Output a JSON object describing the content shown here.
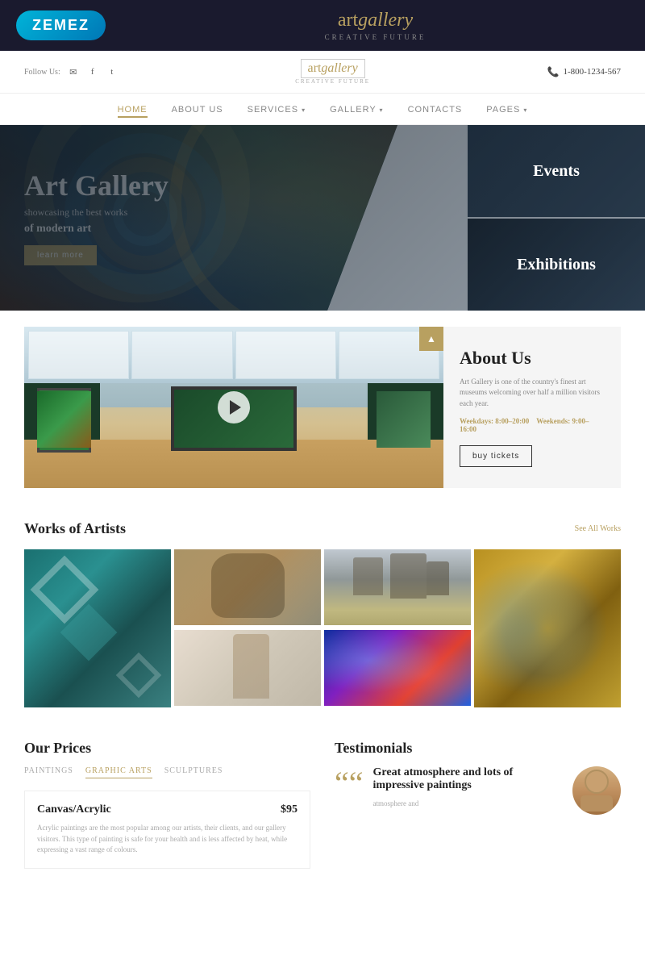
{
  "brand": {
    "zemez_label": "ZEMEZ",
    "logo_art": "art",
    "logo_gallery": "gallery",
    "tagline": "CREATIVE FUTURE"
  },
  "topbar": {
    "follow_us_label": "Follow Us:",
    "phone": "1-800-1234-567",
    "logo_art": "art",
    "logo_gallery": "gallery",
    "tagline": "CREATIVE FUTURE"
  },
  "nav": {
    "items": [
      {
        "label": "HOME",
        "active": true
      },
      {
        "label": "ABOUT US",
        "active": false
      },
      {
        "label": "SERVICES",
        "active": false,
        "has_arrow": true
      },
      {
        "label": "GALLERY",
        "active": false,
        "has_arrow": true
      },
      {
        "label": "CONTACTS",
        "active": false
      },
      {
        "label": "PAGES",
        "active": false,
        "has_arrow": true
      }
    ]
  },
  "hero": {
    "title": "Art Gallery",
    "subtitle": "showcasing the best works",
    "subtitle_bold": "of modern art",
    "cta_button": "learn more",
    "events_label": "Events",
    "exhibitions_label": "Exhibitions"
  },
  "about": {
    "title": "About Us",
    "description": "Art Gallery is one of the country's finest art museums welcoming over half a million visitors each year.",
    "weekdays_label": "Weekdays:",
    "weekdays_hours": "8:00–20:00",
    "weekends_label": "Weekends:",
    "weekends_hours": "9:00–16:00",
    "cta_button": "buy tickets"
  },
  "works": {
    "section_title": "Works of Artists",
    "see_all_label": "See All Works"
  },
  "prices": {
    "section_title": "Our Prices",
    "tabs": [
      {
        "label": "PAINTINGS",
        "active": false
      },
      {
        "label": "GRAPHIC ARTS",
        "active": true
      },
      {
        "label": "SCULPTURES",
        "active": false
      }
    ],
    "card": {
      "name": "Canvas/Acrylic",
      "amount": "$95",
      "description": "Acrylic paintings are the most popular among our artists, their clients, and our gallery visitors. This type of painting is safe for your health and is less affected by heat, while expressing a vast range of colours."
    }
  },
  "testimonials": {
    "section_title": "Testimonials",
    "card": {
      "title": "Great atmosphere and lots of impressive paintings",
      "body": "atmosphere and",
      "quote_mark": "““"
    }
  }
}
